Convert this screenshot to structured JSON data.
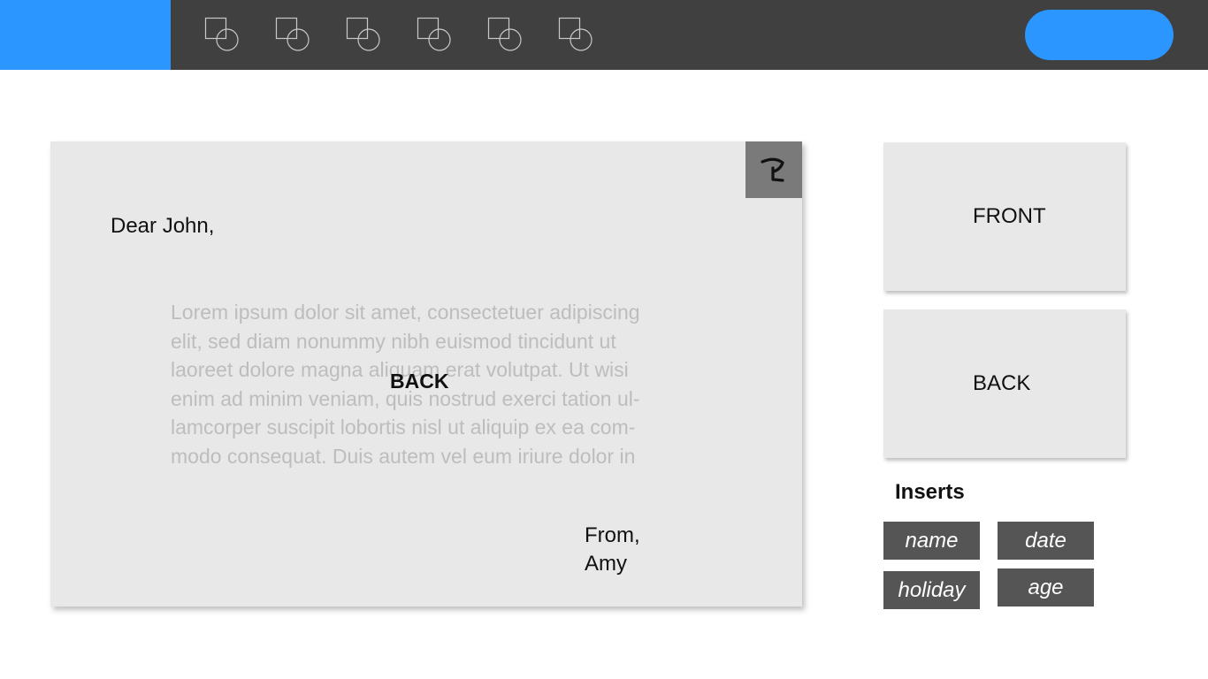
{
  "toolbar": {
    "tools": [
      {
        "icon": "shape-tool-icon"
      },
      {
        "icon": "shape-tool-icon"
      },
      {
        "icon": "shape-tool-icon"
      },
      {
        "icon": "shape-tool-icon"
      },
      {
        "icon": "shape-tool-icon"
      },
      {
        "icon": "shape-tool-icon"
      }
    ],
    "colors": {
      "brand": "#2b96ff",
      "bar": "#404040"
    }
  },
  "card": {
    "flip_icon": "flip-icon",
    "greeting": "Dear John,",
    "body_text": "Lorem ipsum dolor sit amet, consectetuer adipiscing\nelit, sed diam nonummy nibh euismod tincidunt ut\nlaoreet dolore magna aliquam erat volutpat. Ut wisi\nenim ad minim veniam, quis nostrud exerci tation ul-\nlamcorper suscipit lobortis nisl ut aliquip ex ea com-\nmodo consequat. Duis autem vel eum iriure dolor in",
    "side_label": "BACK",
    "sign_off_line1": "From,",
    "sign_off_line2": "Amy"
  },
  "sides": {
    "front_label": "FRONT",
    "back_label": "BACK"
  },
  "inserts": {
    "title": "Inserts",
    "chips": [
      "name",
      "date",
      "holiday",
      "age"
    ]
  }
}
